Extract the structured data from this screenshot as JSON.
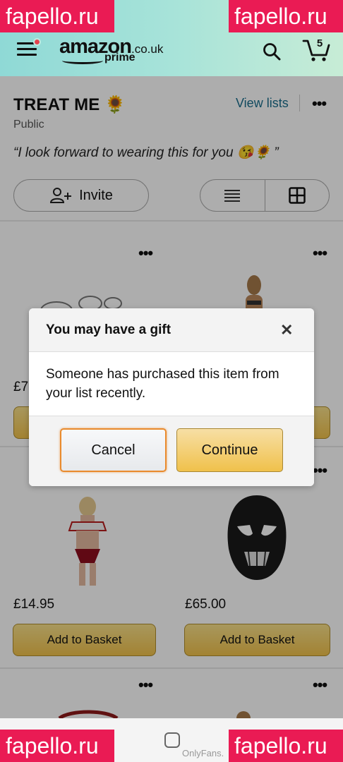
{
  "header": {
    "logo_word": "amazon",
    "logo_tld": ".co.uk",
    "logo_sub": "prime",
    "cart_count": "5"
  },
  "watermark": {
    "text": "fapello.ru"
  },
  "list": {
    "title": "TREAT ME 🌻",
    "visibility": "Public",
    "view_lists": "View lists",
    "more": "•••",
    "quote": "“I look forward to wearing this for you 😘🌻 ”",
    "invite_label": "Invite"
  },
  "items": [
    {
      "price": "£7",
      "more": "•••"
    },
    {
      "price": "",
      "more": "•••"
    },
    {
      "price": "£14.95",
      "more": "•••",
      "button": "Add to Basket"
    },
    {
      "price": "£65.00",
      "more": "•••",
      "button": "Add to Basket"
    },
    {
      "more": "•••"
    },
    {
      "more": "•••"
    }
  ],
  "dialog": {
    "title": "You may have a gift",
    "close": "✕",
    "body": "Someone has purchased this item from your list recently.",
    "cancel": "Cancel",
    "continue": "Continue"
  },
  "navbar": {
    "watermark_small": "OnlyFans."
  },
  "colors": {
    "accent_teal": "#8fd9d6",
    "button_gold": "#f0c14b",
    "watermark_red": "#ea1b54",
    "link_blue": "#1a6e8d"
  }
}
